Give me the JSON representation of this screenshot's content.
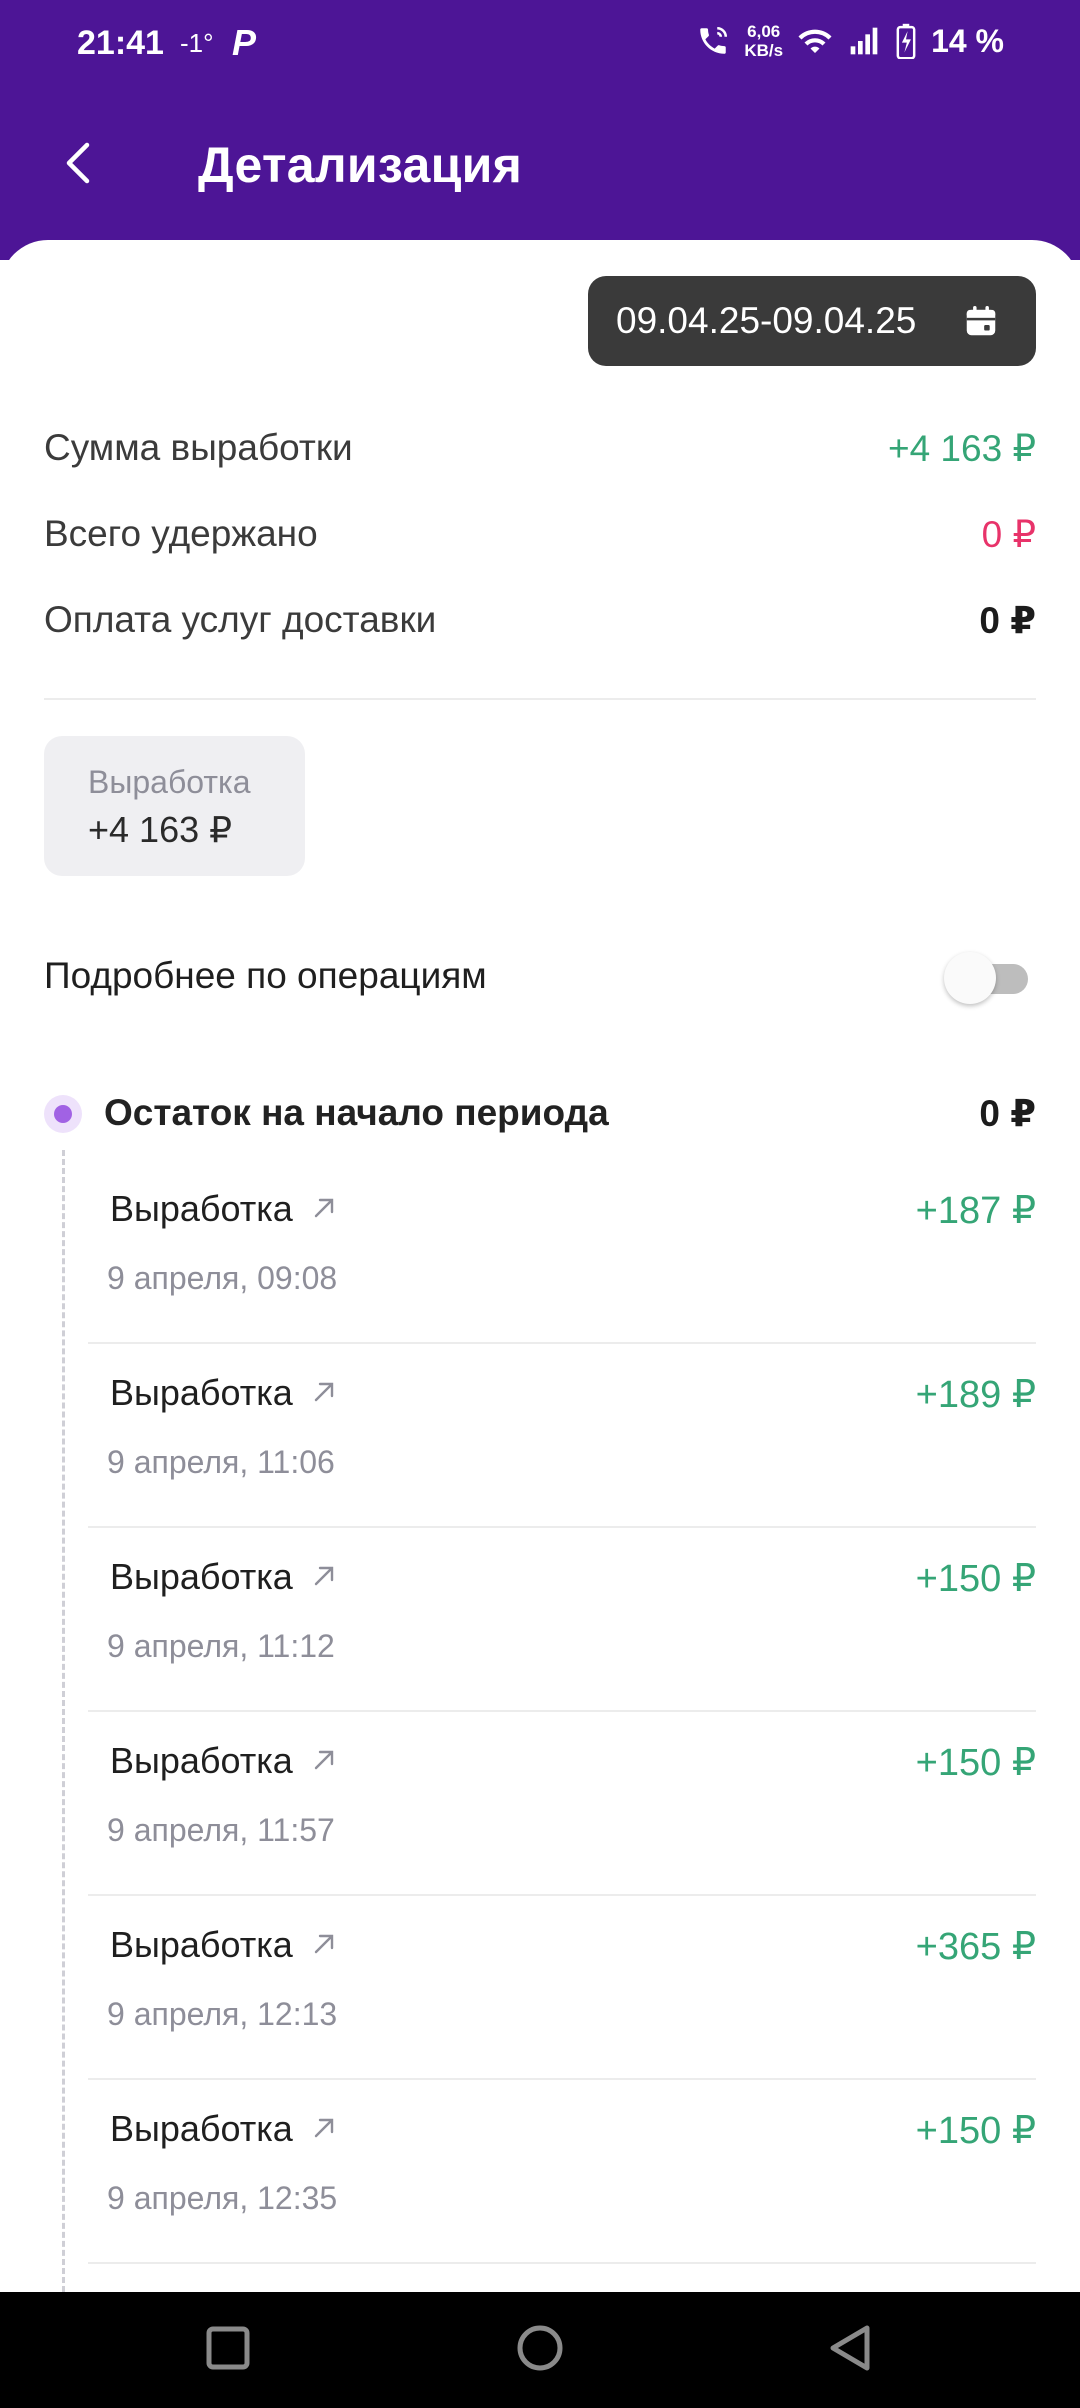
{
  "status_bar": {
    "time": "21:41",
    "temperature": "-1°",
    "net_speed_value": "6,06",
    "net_speed_unit": "KB/s",
    "battery": "14 %",
    "app_glyph": "Р"
  },
  "header": {
    "title": "Детализация",
    "background_color": "#4d1596"
  },
  "date_filter": {
    "range": "09.04.25-09.04.25"
  },
  "summary": [
    {
      "label": "Сумма выработки",
      "value": "+4 163 ₽",
      "tone": "green"
    },
    {
      "label": "Всего удержано",
      "value": "0 ₽",
      "tone": "red"
    },
    {
      "label": "Оплата услуг доставки",
      "value": "0 ₽",
      "tone": "dark"
    }
  ],
  "tile": {
    "label": "Выработка",
    "value": "+4 163 ₽"
  },
  "details_toggle": {
    "label": "Подробнее по операциям",
    "on": false
  },
  "period_start": {
    "label": "Остаток на начало периода",
    "value": "0 ₽"
  },
  "operations": [
    {
      "title": "Выработка",
      "date": "9 апреля, 09:08",
      "amount": "+187 ₽"
    },
    {
      "title": "Выработка",
      "date": "9 апреля, 11:06",
      "amount": "+189 ₽"
    },
    {
      "title": "Выработка",
      "date": "9 апреля, 11:12",
      "amount": "+150 ₽"
    },
    {
      "title": "Выработка",
      "date": "9 апреля, 11:57",
      "amount": "+150 ₽"
    },
    {
      "title": "Выработка",
      "date": "9 апреля, 12:13",
      "amount": "+365 ₽"
    },
    {
      "title": "Выработка",
      "date": "9 апреля, 12:35",
      "amount": "+150 ₽"
    }
  ],
  "colors": {
    "accent": "#4d1596",
    "positive": "#35a576",
    "negative": "#e8336a",
    "timeline_dot": "#a162e4"
  },
  "icons": {
    "back": "arrow-left-icon",
    "calendar": "calendar-icon",
    "operation": "arrow-up-right-icon",
    "nav_recents": "square-icon",
    "nav_home": "circle-icon",
    "nav_back": "triangle-back-icon"
  }
}
